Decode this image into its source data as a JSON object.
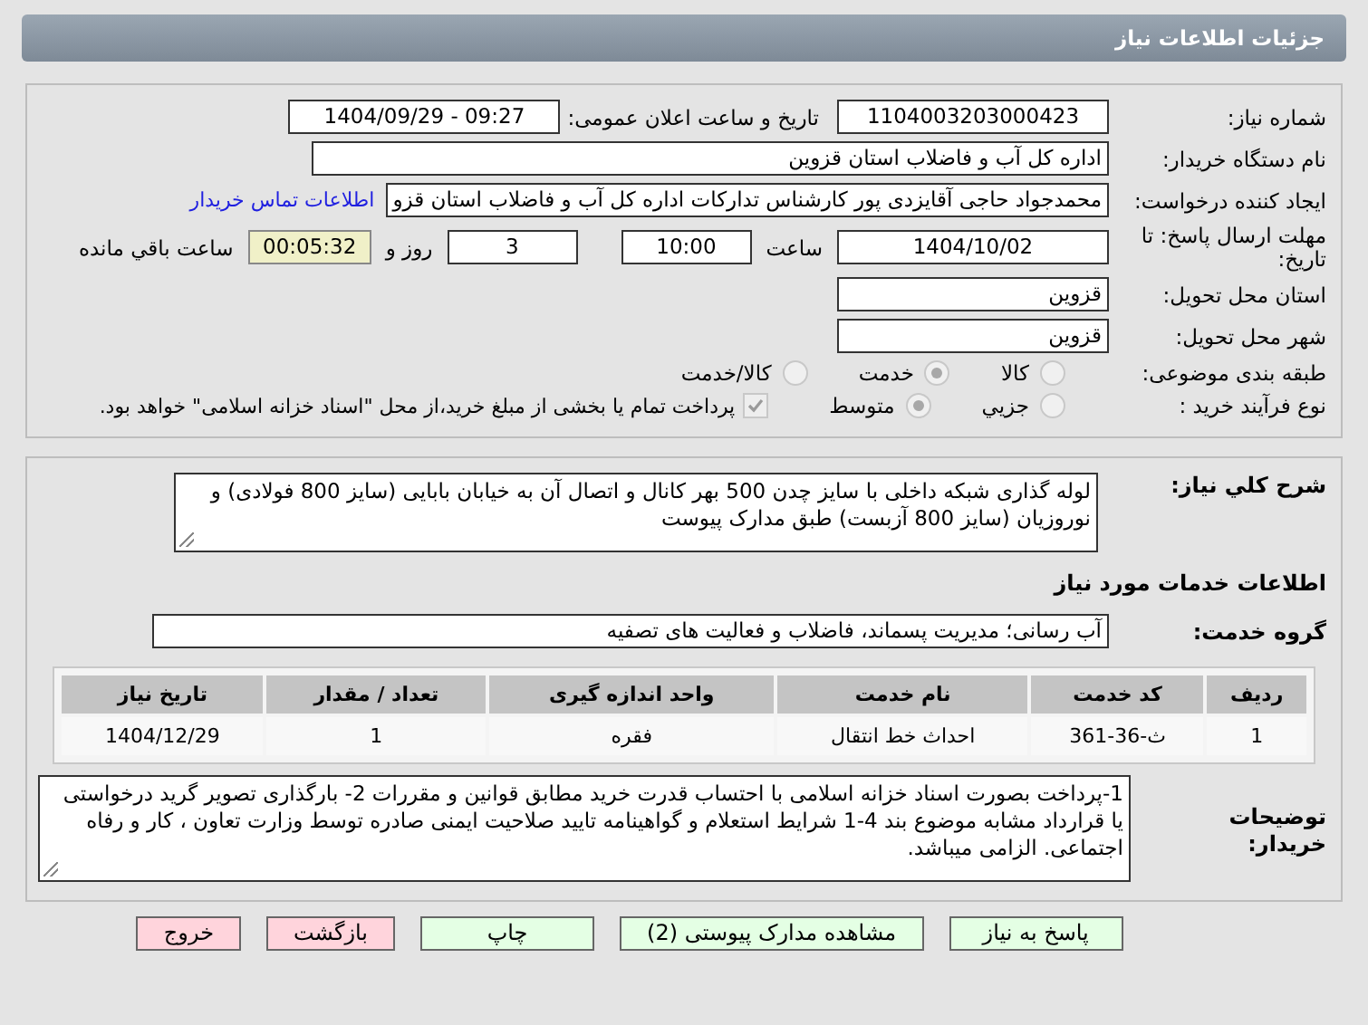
{
  "header": {
    "title": "جزئیات اطلاعات نیاز"
  },
  "need_number": {
    "label": "شماره نیاز:",
    "value": "1104003203000423"
  },
  "announce_date": {
    "label": "تاریخ و ساعت اعلان عمومی:",
    "value": "1404/09/29 - 09:27"
  },
  "buyer_org": {
    "label": "نام دستگاه خریدار:",
    "value": "اداره کل آب و فاضلاب استان قزوین"
  },
  "requester": {
    "label": "ایجاد کننده درخواست:",
    "value": "محمدجواد حاجی آقایزدی پور کارشناس تدارکات اداره کل آب و فاضلاب استان قزو",
    "link": "اطلاعات تماس خریدار"
  },
  "deadline": {
    "label": "مهلت ارسال پاسخ: تا تاریخ:",
    "date": "1404/10/02",
    "time_label": "ساعت",
    "time": "10:00",
    "days": "3",
    "days_label": "روز و",
    "remaining": "00:05:32",
    "remaining_label": "ساعت باقي مانده"
  },
  "province": {
    "label": "استان محل تحویل:",
    "value": "قزوین"
  },
  "city": {
    "label": "شهر محل تحویل:",
    "value": "قزوین"
  },
  "category": {
    "label": "طبقه بندی موضوعی:",
    "options": [
      {
        "label": "کالا",
        "selected": false
      },
      {
        "label": "خدمت",
        "selected": true
      },
      {
        "label": "کالا/خدمت",
        "selected": false
      }
    ]
  },
  "purchase_type": {
    "label": "نوع فرآیند خرید :",
    "options": [
      {
        "label": "جزيي",
        "selected": false
      },
      {
        "label": "متوسط",
        "selected": true
      }
    ],
    "treasury": {
      "checked": true,
      "text": "پرداخت تمام یا بخشی از مبلغ خرید،از محل \"اسناد خزانه اسلامی\" خواهد بود."
    }
  },
  "description": {
    "label": "شرح کلي نياز:",
    "value": "لوله گذاری شبکه داخلی  با سایز چدن 500 بهر کانال و اتصال آن به خیابان بابایی (سایز 800  فولادی) و نوروزیان (سایز 800 آزبست) طبق مدارک پیوست"
  },
  "services_heading": "اطلاعات خدمات مورد نیاز",
  "service_group": {
    "label": "گروه خدمت:",
    "value": "آب رسانی؛ مدیریت پسماند، فاضلاب و فعالیت های تصفیه"
  },
  "table": {
    "columns": [
      "ردیف",
      "کد خدمت",
      "نام خدمت",
      "واحد اندازه گیری",
      "تعداد / مقدار",
      "تاریخ نیاز"
    ],
    "rows": [
      [
        "1",
        "ث-36-361",
        "احداث خط انتقال",
        "فقره",
        "1",
        "1404/12/29"
      ]
    ]
  },
  "buyer_notes": {
    "label": "توضیحات خریدار:",
    "value": "1-پرداخت بصورت اسناد خزانه اسلامی با احتساب قدرت خرید مطابق قوانین و مقررات 2- بارگذاری تصویر گرید درخواستی یا قرارداد مشابه موضوع بند 4-1 شرایط استعلام و گواهینامه تایید صلاحیت ایمنی صادره توسط وزارت تعاون ، کار و رفاه اجتماعی. الزامی میباشد."
  },
  "buttons": [
    {
      "label": "پاسخ به نیاز",
      "kind": "normal"
    },
    {
      "label": "مشاهده مدارک پیوستی (2)",
      "kind": "normal"
    },
    {
      "label": "چاپ",
      "kind": "normal"
    },
    {
      "label": "بازگشت",
      "kind": "danger"
    },
    {
      "label": "خروج",
      "kind": "danger"
    }
  ]
}
